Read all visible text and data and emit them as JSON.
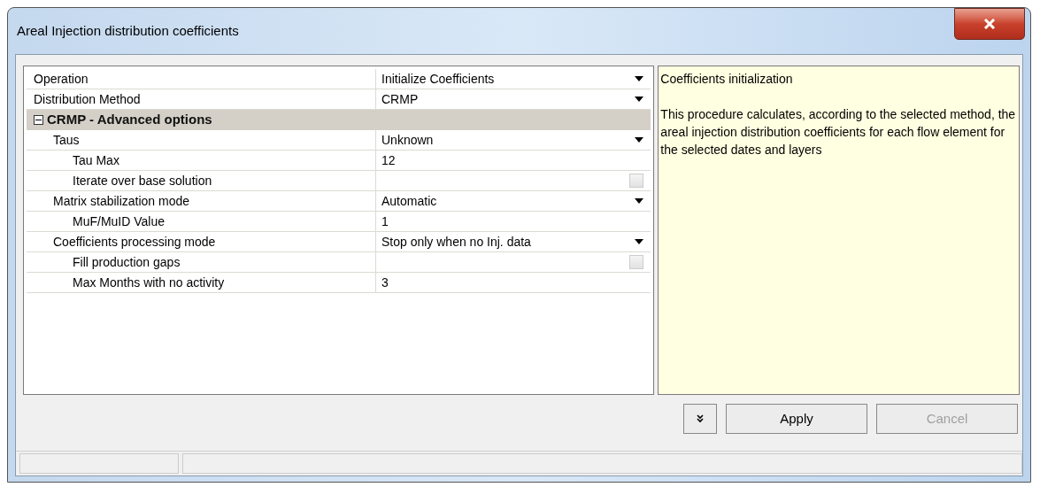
{
  "window": {
    "title": "Areal Injection distribution coefficients"
  },
  "properties": [
    {
      "kind": "dropdown",
      "label": "Operation",
      "value": "Initialize Coefficients"
    },
    {
      "kind": "dropdown",
      "label": "Distribution Method",
      "value": "CRMP"
    },
    {
      "kind": "group",
      "label": "CRMP - Advanced options",
      "expanded": true,
      "children": [
        {
          "kind": "dropdown",
          "label": "Taus",
          "value": "Unknown",
          "children": [
            {
              "kind": "text",
              "label": "Tau Max",
              "value": "12"
            },
            {
              "kind": "checkbox",
              "label": "Iterate over base solution",
              "checked": false
            }
          ]
        },
        {
          "kind": "dropdown",
          "label": "Matrix stabilization mode",
          "value": "Automatic",
          "children": [
            {
              "kind": "text",
              "label": "MuF/MuID Value",
              "value": "1"
            }
          ]
        },
        {
          "kind": "dropdown",
          "label": "Coefficients processing mode",
          "value": "Stop only when no Inj. data",
          "children": [
            {
              "kind": "checkbox",
              "label": "Fill production gaps",
              "checked": false
            },
            {
              "kind": "text",
              "label": "Max Months with no activity",
              "value": "3"
            }
          ]
        }
      ]
    }
  ],
  "help": {
    "title": "Coefficients initialization",
    "body": "This procedure calculates, according to the selected method, the areal injection distribution coefficients for each flow element for the selected dates and layers"
  },
  "buttons": [
    {
      "kind": "more"
    },
    {
      "kind": "text",
      "label": "Apply",
      "disabled": false
    },
    {
      "kind": "text",
      "label": "Cancel",
      "disabled": true
    }
  ]
}
